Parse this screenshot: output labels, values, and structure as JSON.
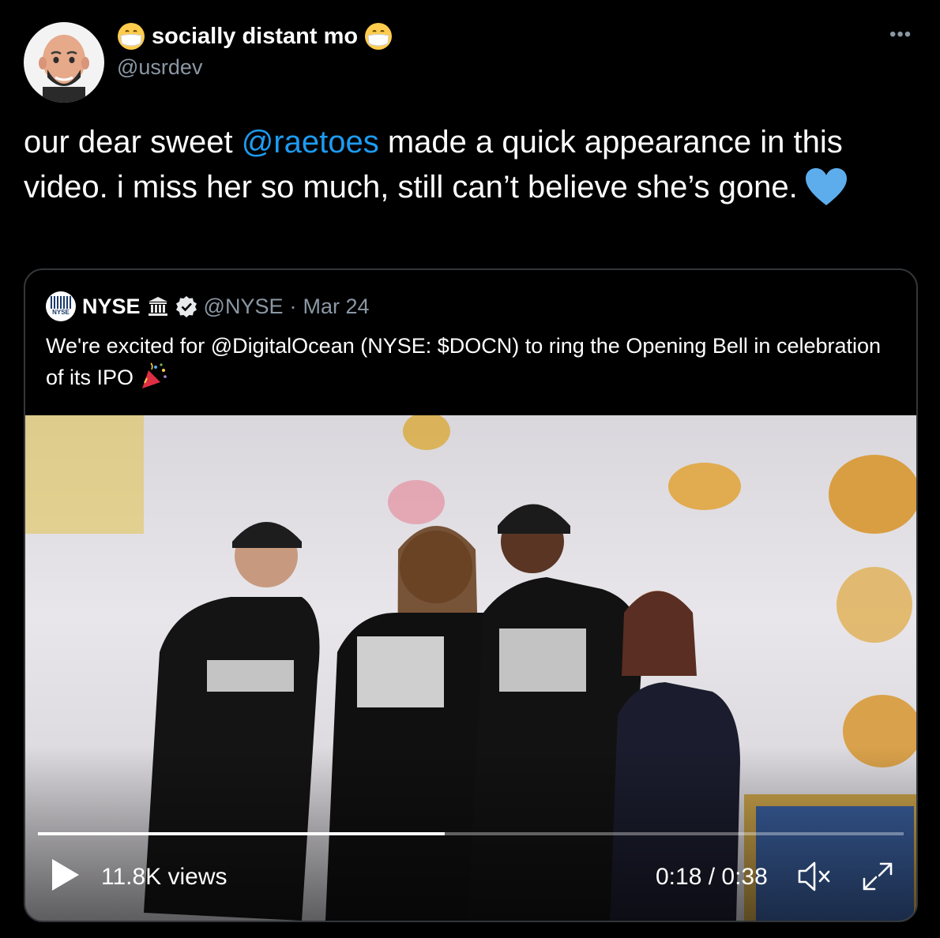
{
  "author": {
    "display_name": "socially distant mo",
    "handle": "@usrdev"
  },
  "tweet": {
    "text_before": "our dear sweet ",
    "mention": "@raetoes",
    "text_after": " made a quick appearance in this video. i miss her so much, still can’t believe she’s gone."
  },
  "quoted": {
    "logo_text": "NYSE",
    "name": "NYSE",
    "handle": "@NYSE",
    "separator": "·",
    "date": "Mar 24",
    "text": "We're excited for @DigitalOcean (NYSE: $DOCN) to ring the Opening Bell in celebration of its IPO",
    "video": {
      "views": "11.8K views",
      "time": "0:18 / 0:38",
      "progress": 0.47
    }
  },
  "icons": {
    "more": "more-icon",
    "play": "play-icon",
    "mute": "muted-speaker-icon",
    "fullscreen": "fullscreen-icon",
    "verified": "verified-badge-icon",
    "heart": "blue-heart-emoji",
    "party": "party-popper-emoji"
  },
  "colors": {
    "background": "#000000",
    "accent": "#1d9bf0",
    "secondary_text": "#8b98a5",
    "border": "#333639"
  }
}
